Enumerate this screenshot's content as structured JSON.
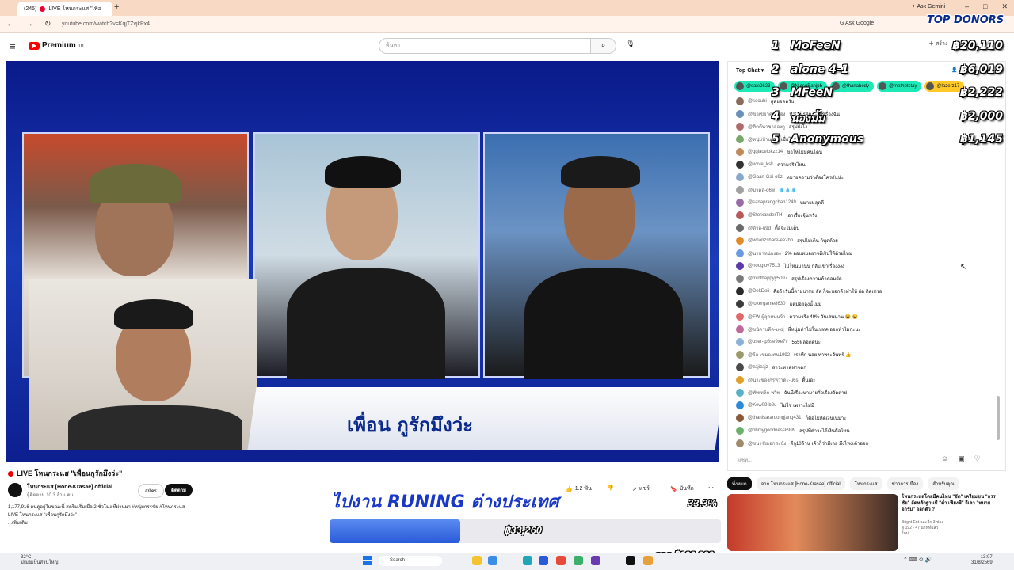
{
  "browser": {
    "tab_badge": "(245)",
    "tab_title": "LIVE โหนกระแส \"เพื่อ",
    "new_tab": "+",
    "url": "youtube.com/watch?v=KqjTZvjkPx4",
    "ask_google": "Ask Google",
    "ask_gemini": "Ask Gemini",
    "window_controls": [
      "–",
      "□",
      "✕"
    ]
  },
  "youtube": {
    "logo_text": "Premium",
    "logo_sup": "TH",
    "search_placeholder": "ค้นหา",
    "create_label": "สร้าง"
  },
  "video": {
    "banner_text": "เพื่อน กูรักมึงว่ะ",
    "title": "LIVE โหนกระแส \"เพื่อนกูรักมึงว่ะ\"",
    "channel_name": "โหนกระแส [Hone-Krasae] official",
    "subscribers": "ผู้ติดตาม 10.3 ล้าน คน",
    "join_label": "สมัคร",
    "subscribe_label": "ติดตาม",
    "likes": "1.2 พัน",
    "share_label": "แชร์",
    "save_label": "บันทึก",
    "description_line1": "1,177,916 คนดูอยู่ในขณะนี้  สตรีมเริ่มเมื่อ 2 ชั่วโมง ที่ผ่านมา  #หนุ่มกรรชัย #โหนกระแส",
    "description_line2": "LIVE โหนกระแส \"เพื่อนกูรักมึงว่ะ\"",
    "description_more": "...เพิ่มเติม"
  },
  "overlay": {
    "goal_title": "ไปงาน RUNING ต่างประเทศ",
    "goal_percent": "33.3%",
    "goal_progress": 0.333,
    "goal_amount": "฿33,260",
    "goal_target": "จาก ฿100,000",
    "top_donors_title": "TOP DONORS",
    "donors": [
      {
        "rank": "1",
        "name": "MoFeeN",
        "amount": "฿20,110"
      },
      {
        "rank": "2",
        "name": "alone 4-1",
        "amount": "฿6,019"
      },
      {
        "rank": "3",
        "name": "MFeeN",
        "amount": "฿2,222"
      },
      {
        "rank": "4",
        "name": "น้องมิ้ม",
        "amount": "฿2,000"
      },
      {
        "rank": "5",
        "name": "Anonymous",
        "amount": "฿1,145"
      }
    ]
  },
  "chat": {
    "header": "Top Chat",
    "viewers": "15K",
    "tickers": [
      {
        "name": "@saie2623"
      },
      {
        "name": "@NutsuBanjph"
      },
      {
        "name": "@thanabody"
      },
      {
        "name": "@mathptstay"
      },
      {
        "name": "@lazerz17"
      }
    ],
    "messages": [
      {
        "author": "@sooubi",
        "text": "สุดยอดครับ",
        "color": "#8a6b5a"
      },
      {
        "author": "@ข้อเขียวคนเมือง",
        "text": "ทำอะไรผิด ไม่ใช่เรื่องฉัน",
        "color": "#6a8fb8"
      },
      {
        "author": "@คิดดีนาชาลองดู",
        "text": "สรุปยังไง",
        "color": "#b06a6a"
      },
      {
        "author": "@หนุ่มบ้านนา",
        "text": "เมื่อไหร่จะจบ",
        "color": "#7aa86a"
      },
      {
        "author": "@ggiacelokzz14",
        "text": "ขอให้ไม่มีคนโดน",
        "color": "#c08a5a"
      },
      {
        "author": "@wxve_ksk",
        "text": "ความจริงไหน",
        "color": "#333333"
      },
      {
        "author": "@Gaan-Gai-o9z",
        "text": "หมายความว่าต้องโครกันน่ะ",
        "color": "#8aa8c8"
      },
      {
        "author": "@มาคล-o6w",
        "text": "💧💧💧",
        "color": "#a0a0a0"
      },
      {
        "author": "@sanaprangchan1249",
        "text": "หมายหลุดดี",
        "color": "#9a6aa8"
      },
      {
        "author": "@StorxanderTH",
        "text": "เอาเรื่องจุ้นหวัง",
        "color": "#b85a5a"
      },
      {
        "author": "@ดำอ้-u9d",
        "text": "ดื้อจะไม่เด็น",
        "color": "#6a6a6a"
      },
      {
        "author": "@whanzshare-ee2bh",
        "text": "สรุปไม่เด็น ก็พูดด้วย",
        "color": "#e08a2a"
      },
      {
        "author": "@นาบาหน่ององ",
        "text": "2% ลอบหมอยาจดีเงินให้ด้วยไหม",
        "color": "#6a9ae0"
      },
      {
        "author": "@noogloy7513",
        "text": "ไปไหนมานน กลับเข้าเรื่องงงง",
        "color": "#5a3aa8"
      },
      {
        "author": "@minthappyy5097",
        "text": "สรุปเรื่องความค้าคอมยัด",
        "color": "#7a7a7a"
      },
      {
        "author": "@DekDoii",
        "text": "คือถ้าวันนี้ตามบาทย อัด ก็จะบอกด้าทำให้ อัด ติดเทรอ",
        "color": "#2a2a2a"
      },
      {
        "author": "@jokergame8630",
        "text": "แต่ม่อยลุงนี้ไม่มี",
        "color": "#3a3a3a"
      },
      {
        "author": "@FW-ผู้อุดหนุนจ้า",
        "text": "ความจริง 49% วันเสนนาน 😂 😂",
        "color": "#e06a6a"
      },
      {
        "author": "@ขนิดาบดีด-บ-oj",
        "text": "พี่หนุ่มต่าไม่ในเบทค ออกทำไมกะนะ",
        "color": "#c06a9a"
      },
      {
        "author": "@user-tp8se9xe7v",
        "text": "555หลอดดนะ",
        "color": "#8ab0d8"
      },
      {
        "author": "@จ้อ-เขมองศน1992",
        "text": "เราทีก นอย ทาพระจันทร์ 👍",
        "color": "#9a9a6a"
      },
      {
        "author": "@zajizajz",
        "text": "สาระหาดหาจดก",
        "color": "#4a4a4a"
      },
      {
        "author": "@นางของกรหว่าดะ-u6s",
        "text": "ดื้นเอะ",
        "color": "#e0a02a"
      },
      {
        "author": "@ทัพเหล็ก-พวิพ",
        "text": "ฉันนี่เรื่องนามายกั่วเรื่องอัดต่าย่",
        "color": "#5ab0c8"
      },
      {
        "author": "@Kew09-b2u",
        "text": "ไม่ใช่ เพราะไม่มี",
        "color": "#2a8ad8"
      },
      {
        "author": "@thanisararoongjang431",
        "text": "ก็คือไม่คิดเงินเนมาะ",
        "color": "#8a5a3a"
      },
      {
        "author": "@ohmygoodness8999",
        "text": "สรุปพี่ด่าจะได้เงินคือไหน",
        "color": "#6ab06a"
      },
      {
        "author": "@ชนาชัยเอกสะนัง",
        "text": "ดีกู10ล้าน เค้าก็ว่ามีเลย มึงไหงเค้าออก",
        "color": "#a08a6a"
      }
    ],
    "input_placeholder": "แชท..."
  },
  "recommendations": {
    "chips": [
      "ทั้งหมด",
      "จาก โหนกระแส [Hone-Krasae] official",
      "โหนกระแส",
      "ข่าวการเมือง",
      "สำหรับคุณ"
    ],
    "title": "โหนกระแสโดยมีคนไหน \"ยัด\" เครียมขน \"กรรชัย\" อัดหลักฐานมี \"ต่ำ เฟียงพี\" จีเลา \"ทนายอาร์ม\" ออกตัว ?",
    "channel": "Bright Ent และอีก 3 ช่อง",
    "views": "ดู 192 · 47 นาทีที่แล้ว",
    "badge": "ใหม่"
  },
  "taskbar": {
    "temp": "32°C",
    "weather": "มีเมฆเป็นส่วนใหญ่",
    "search": "Search",
    "time": "13:07",
    "date": "31/8/2569"
  }
}
